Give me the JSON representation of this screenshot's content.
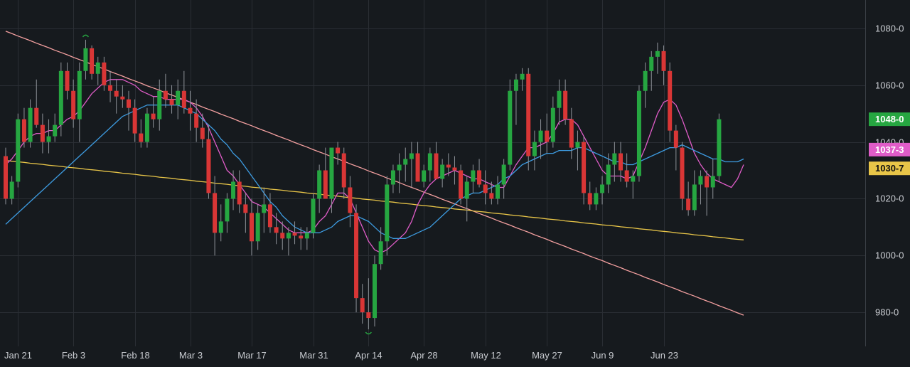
{
  "theme": {
    "background": "#161a1e",
    "grid": "#2a2e34",
    "axis_text": "#c9ccd1",
    "up_color": "#26a641",
    "down_color": "#d93636",
    "wick_color": "#8e9399"
  },
  "chart_data": {
    "type": "candlestick",
    "title": "",
    "xlabel": "",
    "ylabel": "",
    "ylim": [
      968,
      1090
    ],
    "y_ticks": [
      "1080-0",
      "1060-0",
      "1040-0",
      "1020-0",
      "1000-0",
      "980-0"
    ],
    "y_tick_values": [
      1080,
      1060,
      1040,
      1020,
      1000,
      980
    ],
    "x_ticks": [
      {
        "label": "Jan 21",
        "index": 2
      },
      {
        "label": "Feb 3",
        "index": 11
      },
      {
        "label": "Feb 18",
        "index": 21
      },
      {
        "label": "Mar 3",
        "index": 30
      },
      {
        "label": "Mar 17",
        "index": 40
      },
      {
        "label": "Mar 31",
        "index": 50
      },
      {
        "label": "Apr 14",
        "index": 59
      },
      {
        "label": "Apr 28",
        "index": 68
      },
      {
        "label": "May 12",
        "index": 78
      },
      {
        "label": "May 27",
        "index": 88
      },
      {
        "label": "Jun 9",
        "index": 97
      },
      {
        "label": "Jun 23",
        "index": 107
      }
    ],
    "candles": [
      [
        1035,
        1038,
        1018,
        1020
      ],
      [
        1020,
        1028,
        1018,
        1026
      ],
      [
        1026,
        1050,
        1024,
        1048
      ],
      [
        1048,
        1052,
        1038,
        1040
      ],
      [
        1040,
        1055,
        1038,
        1052
      ],
      [
        1052,
        1062,
        1045,
        1046
      ],
      [
        1046,
        1050,
        1036,
        1040
      ],
      [
        1040,
        1048,
        1036,
        1042
      ],
      [
        1042,
        1050,
        1040,
        1046
      ],
      [
        1046,
        1068,
        1042,
        1065
      ],
      [
        1065,
        1068,
        1055,
        1058
      ],
      [
        1058,
        1062,
        1045,
        1048
      ],
      [
        1048,
        1068,
        1040,
        1065
      ],
      [
        1065,
        1076,
        1062,
        1073
      ],
      [
        1073,
        1074,
        1062,
        1064
      ],
      [
        1064,
        1070,
        1060,
        1068
      ],
      [
        1068,
        1070,
        1058,
        1060
      ],
      [
        1060,
        1065,
        1054,
        1058
      ],
      [
        1058,
        1062,
        1050,
        1056
      ],
      [
        1056,
        1060,
        1052,
        1055
      ],
      [
        1055,
        1058,
        1044,
        1052
      ],
      [
        1052,
        1055,
        1040,
        1043
      ],
      [
        1043,
        1048,
        1038,
        1040
      ],
      [
        1040,
        1052,
        1038,
        1050
      ],
      [
        1050,
        1056,
        1045,
        1048
      ],
      [
        1048,
        1062,
        1044,
        1058
      ],
      [
        1058,
        1064,
        1052,
        1055
      ],
      [
        1055,
        1060,
        1050,
        1053
      ],
      [
        1053,
        1062,
        1048,
        1058
      ],
      [
        1058,
        1065,
        1050,
        1052
      ],
      [
        1052,
        1058,
        1044,
        1050
      ],
      [
        1050,
        1055,
        1040,
        1045
      ],
      [
        1045,
        1050,
        1038,
        1041
      ],
      [
        1041,
        1046,
        1020,
        1022
      ],
      [
        1022,
        1028,
        1000,
        1008
      ],
      [
        1008,
        1018,
        1005,
        1012
      ],
      [
        1012,
        1022,
        1008,
        1020
      ],
      [
        1020,
        1030,
        1016,
        1026
      ],
      [
        1026,
        1030,
        1015,
        1018
      ],
      [
        1018,
        1022,
        1008,
        1015
      ],
      [
        1015,
        1020,
        1000,
        1005
      ],
      [
        1005,
        1018,
        1002,
        1015
      ],
      [
        1015,
        1024,
        1008,
        1018
      ],
      [
        1018,
        1022,
        1008,
        1010
      ],
      [
        1010,
        1015,
        1004,
        1008
      ],
      [
        1008,
        1012,
        1002,
        1006
      ],
      [
        1006,
        1010,
        1000,
        1008
      ],
      [
        1008,
        1012,
        1004,
        1007
      ],
      [
        1007,
        1010,
        1002,
        1006
      ],
      [
        1006,
        1010,
        1002,
        1008
      ],
      [
        1008,
        1022,
        1006,
        1020
      ],
      [
        1020,
        1032,
        1015,
        1030
      ],
      [
        1030,
        1038,
        1025,
        1020
      ],
      [
        1020,
        1028,
        1015,
        1038
      ],
      [
        1038,
        1040,
        1032,
        1036
      ],
      [
        1036,
        1038,
        1020,
        1024
      ],
      [
        1024,
        1028,
        1010,
        1015
      ],
      [
        1015,
        1018,
        980,
        985
      ],
      [
        985,
        990,
        976,
        980
      ],
      [
        980,
        992,
        974,
        978
      ],
      [
        978,
        1000,
        975,
        997
      ],
      [
        997,
        1010,
        995,
        1005
      ],
      [
        1005,
        1028,
        1000,
        1025
      ],
      [
        1025,
        1032,
        1022,
        1030
      ],
      [
        1030,
        1036,
        1022,
        1032
      ],
      [
        1032,
        1038,
        1026,
        1034
      ],
      [
        1034,
        1040,
        1024,
        1036
      ],
      [
        1036,
        1040,
        1030,
        1026
      ],
      [
        1026,
        1032,
        1024,
        1030
      ],
      [
        1030,
        1038,
        1026,
        1036
      ],
      [
        1036,
        1040,
        1030,
        1027
      ],
      [
        1027,
        1034,
        1024,
        1032
      ],
      [
        1032,
        1036,
        1028,
        1031
      ],
      [
        1031,
        1035,
        1025,
        1030
      ],
      [
        1030,
        1032,
        1018,
        1020
      ],
      [
        1020,
        1028,
        1012,
        1026
      ],
      [
        1026,
        1032,
        1022,
        1030
      ],
      [
        1030,
        1034,
        1024,
        1025
      ],
      [
        1025,
        1030,
        1018,
        1022
      ],
      [
        1022,
        1026,
        1018,
        1020
      ],
      [
        1020,
        1028,
        1018,
        1025
      ],
      [
        1025,
        1034,
        1020,
        1032
      ],
      [
        1032,
        1062,
        1030,
        1058
      ],
      [
        1058,
        1064,
        1046,
        1062
      ],
      [
        1062,
        1066,
        1058,
        1064
      ],
      [
        1064,
        1066,
        1030,
        1035
      ],
      [
        1035,
        1044,
        1030,
        1040
      ],
      [
        1040,
        1048,
        1034,
        1044
      ],
      [
        1044,
        1050,
        1036,
        1040
      ],
      [
        1040,
        1056,
        1038,
        1052
      ],
      [
        1052,
        1062,
        1046,
        1058
      ],
      [
        1058,
        1062,
        1046,
        1048
      ],
      [
        1048,
        1052,
        1034,
        1038
      ],
      [
        1038,
        1044,
        1030,
        1040
      ],
      [
        1040,
        1042,
        1018,
        1022
      ],
      [
        1022,
        1026,
        1016,
        1018
      ],
      [
        1018,
        1024,
        1016,
        1022
      ],
      [
        1022,
        1028,
        1018,
        1025
      ],
      [
        1025,
        1036,
        1022,
        1032
      ],
      [
        1032,
        1040,
        1026,
        1036
      ],
      [
        1036,
        1040,
        1026,
        1030
      ],
      [
        1030,
        1036,
        1024,
        1026
      ],
      [
        1026,
        1030,
        1020,
        1028
      ],
      [
        1028,
        1060,
        1026,
        1058
      ],
      [
        1058,
        1068,
        1052,
        1065
      ],
      [
        1065,
        1072,
        1058,
        1070
      ],
      [
        1070,
        1075,
        1064,
        1072
      ],
      [
        1072,
        1074,
        1060,
        1065
      ],
      [
        1065,
        1068,
        1040,
        1044
      ],
      [
        1044,
        1046,
        1030,
        1038
      ],
      [
        1038,
        1040,
        1016,
        1020
      ],
      [
        1020,
        1026,
        1014,
        1016
      ],
      [
        1016,
        1030,
        1014,
        1025
      ],
      [
        1025,
        1030,
        1018,
        1028
      ],
      [
        1028,
        1030,
        1014,
        1024
      ],
      [
        1024,
        1034,
        1020,
        1028
      ],
      [
        1028,
        1050,
        1026,
        1048
      ]
    ],
    "series": [
      {
        "color": "#f4a0a0",
        "values": [
          1079.0,
          1078.2,
          1077.3,
          1076.5,
          1075.7,
          1074.8,
          1074.0,
          1073.2,
          1072.3,
          1071.5,
          1070.7,
          1069.8,
          1069.0,
          1068.2,
          1067.3,
          1066.5,
          1065.7,
          1064.8,
          1064.0,
          1063.2,
          1062.3,
          1061.5,
          1060.7,
          1059.8,
          1059.0,
          1058.2,
          1057.3,
          1056.5,
          1055.7,
          1054.8,
          1054.0,
          1053.2,
          1052.3,
          1051.5,
          1050.7,
          1049.8,
          1049.0,
          1048.2,
          1047.3,
          1046.5,
          1045.7,
          1044.8,
          1044.0,
          1043.2,
          1042.3,
          1041.5,
          1040.7,
          1039.8,
          1039.0,
          1038.2,
          1037.3,
          1036.5,
          1035.7,
          1034.8,
          1034.0,
          1033.2,
          1032.3,
          1031.5,
          1030.7,
          1029.8,
          1029.0,
          1028.2,
          1027.3,
          1026.5,
          1025.7,
          1024.8,
          1024.0,
          1023.2,
          1022.3,
          1021.5,
          1020.7,
          1019.8,
          1019.0,
          1018.2,
          1017.3,
          1016.5,
          1015.7,
          1014.8,
          1014.0,
          1013.2,
          1012.3,
          1011.5,
          1010.7,
          1009.8,
          1009.0,
          1008.2,
          1007.3,
          1006.5,
          1005.7,
          1004.8,
          1004.0,
          1003.2,
          1002.3,
          1001.5,
          1000.7,
          999.8,
          999.0,
          998.2,
          997.3,
          996.5,
          995.7,
          994.8,
          994.0,
          993.2,
          992.3,
          991.5,
          990.7,
          989.8,
          989.0,
          988.2,
          987.3,
          986.5,
          985.7,
          984.8,
          984.0,
          983.2,
          982.3,
          981.5,
          980.7,
          979.8,
          979.0
        ]
      },
      {
        "color": "#e8c548",
        "values": [
          1033.5,
          1033.2,
          1033.0,
          1032.8,
          1032.5,
          1032.3,
          1032.1,
          1031.8,
          1031.6,
          1031.4,
          1031.1,
          1030.9,
          1030.7,
          1030.4,
          1030.2,
          1030.0,
          1029.7,
          1029.5,
          1029.3,
          1029.0,
          1028.8,
          1028.6,
          1028.3,
          1028.1,
          1027.9,
          1027.6,
          1027.4,
          1027.2,
          1026.9,
          1026.7,
          1026.5,
          1026.2,
          1026.0,
          1025.8,
          1025.5,
          1025.3,
          1025.1,
          1024.8,
          1024.6,
          1024.4,
          1024.1,
          1023.9,
          1023.7,
          1023.4,
          1023.2,
          1023.0,
          1022.7,
          1022.5,
          1022.3,
          1022.0,
          1021.8,
          1021.6,
          1021.3,
          1021.1,
          1020.9,
          1020.6,
          1020.4,
          1020.2,
          1019.9,
          1019.7,
          1019.5,
          1019.2,
          1019.0,
          1018.8,
          1018.5,
          1018.3,
          1018.1,
          1017.8,
          1017.6,
          1017.4,
          1017.1,
          1016.9,
          1016.7,
          1016.4,
          1016.2,
          1016.0,
          1015.7,
          1015.5,
          1015.3,
          1015.0,
          1014.8,
          1014.6,
          1014.3,
          1014.1,
          1013.9,
          1013.6,
          1013.4,
          1013.2,
          1012.9,
          1012.7,
          1012.5,
          1012.2,
          1012.0,
          1011.8,
          1011.5,
          1011.3,
          1011.1,
          1010.8,
          1010.6,
          1010.4,
          1010.1,
          1009.9,
          1009.7,
          1009.4,
          1009.2,
          1009.0,
          1008.7,
          1008.5,
          1008.3,
          1008.0,
          1007.8,
          1007.6,
          1007.3,
          1007.1,
          1006.9,
          1006.6,
          1006.4,
          1006.2,
          1005.9,
          1005.7,
          1005.5
        ]
      },
      {
        "color": "#e05cc8",
        "values": [
          1032,
          1034,
          1037,
          1040,
          1042,
          1043,
          1043,
          1044,
          1044,
          1046,
          1048,
          1049,
          1051,
          1054,
          1057,
          1059,
          1061,
          1062,
          1062,
          1062,
          1061,
          1060,
          1058,
          1057,
          1056,
          1056,
          1055,
          1055,
          1055,
          1055,
          1054,
          1052,
          1049,
          1045,
          1040,
          1035,
          1030,
          1028,
          1025,
          1022,
          1019,
          1018,
          1017,
          1015,
          1013,
          1011,
          1009,
          1008,
          1008,
          1008,
          1009,
          1012,
          1014,
          1018,
          1022,
          1022,
          1020,
          1015,
          1010,
          1005,
          1002,
          1001,
          1002,
          1004,
          1006,
          1008,
          1012,
          1018,
          1022,
          1025,
          1027,
          1028,
          1029,
          1030,
          1029,
          1028,
          1027,
          1027,
          1026,
          1025,
          1024,
          1024,
          1028,
          1032,
          1035,
          1038,
          1038,
          1039,
          1040,
          1043,
          1047,
          1048,
          1048,
          1046,
          1042,
          1038,
          1034,
          1030,
          1028,
          1028,
          1028,
          1027,
          1028,
          1033,
          1038,
          1044,
          1050,
          1054,
          1055,
          1053,
          1048,
          1042,
          1036,
          1032,
          1029,
          1027,
          1026,
          1025,
          1024,
          1027,
          1032
        ]
      },
      {
        "color": "#3d9be0",
        "values": [
          1011,
          1013,
          1015,
          1017,
          1019,
          1021,
          1023,
          1025,
          1027,
          1029,
          1031,
          1033,
          1035,
          1037,
          1039,
          1041,
          1043,
          1045,
          1047,
          1049,
          1050,
          1051,
          1052,
          1053,
          1053,
          1053,
          1053,
          1053,
          1053,
          1052,
          1051,
          1050,
          1048,
          1046,
          1044,
          1041,
          1039,
          1036,
          1034,
          1031,
          1028,
          1025,
          1022,
          1019,
          1017,
          1014,
          1012,
          1010,
          1009,
          1008,
          1008,
          1008,
          1009,
          1010,
          1012,
          1013,
          1014,
          1014,
          1013,
          1012,
          1010,
          1008,
          1007,
          1006,
          1006,
          1006,
          1007,
          1008,
          1009,
          1010,
          1012,
          1014,
          1016,
          1018,
          1020,
          1021,
          1022,
          1022,
          1023,
          1024,
          1025,
          1027,
          1028,
          1030,
          1032,
          1033,
          1034,
          1035,
          1036,
          1036,
          1037,
          1037,
          1037,
          1038,
          1038,
          1037,
          1036,
          1035,
          1034,
          1033,
          1033,
          1032,
          1032,
          1033,
          1034,
          1035,
          1036,
          1037,
          1038,
          1038,
          1039,
          1038,
          1037,
          1036,
          1035,
          1034,
          1034,
          1033,
          1033,
          1033,
          1034
        ]
      }
    ],
    "price_badges": [
      {
        "label": "1048-0",
        "value": 1048,
        "color": "#26a641",
        "text_color": "#ffffff"
      },
      {
        "label": "1037-3",
        "value": 1037.3,
        "color": "#e05cc8",
        "text_color": "#ffffff"
      },
      {
        "label": "1030-7",
        "value": 1030.7,
        "color": "#e8c548",
        "text_color": "#111111"
      }
    ],
    "swing_markers": [
      {
        "index": 13,
        "type": "high"
      },
      {
        "index": 59,
        "type": "low"
      }
    ],
    "grid": true,
    "legend": "none"
  }
}
